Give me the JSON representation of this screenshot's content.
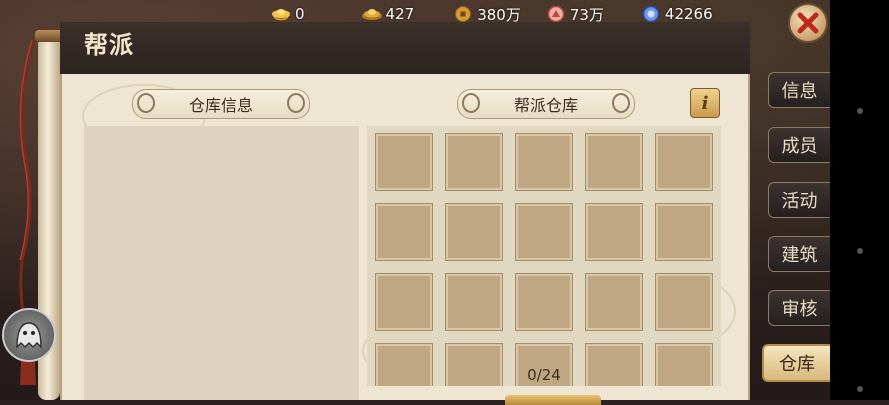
{
  "resources": [
    {
      "name": "gold-ingot",
      "icon": "gold-ingot-icon",
      "value": "0",
      "color": "#e6b93a"
    },
    {
      "name": "silver-ingot",
      "icon": "silver-ingot-icon",
      "value": "427",
      "color": "#d8a540"
    },
    {
      "name": "coins",
      "icon": "copper-coin-icon",
      "value": "380万",
      "color": "#c98a2e"
    },
    {
      "name": "vitality",
      "icon": "red-orb-icon",
      "value": "73万",
      "color": "#d0504a"
    },
    {
      "name": "energy",
      "icon": "blue-orb-icon",
      "value": "42266",
      "color": "#4f7fd6"
    }
  ],
  "panel": {
    "title": "帮派",
    "left_section_title": "仓库信息",
    "right_section_title": "帮派仓库",
    "info_button_label": "i",
    "slot_count": "0/24",
    "visible_slots": 20
  },
  "tabs": [
    {
      "label": "信息",
      "active": false
    },
    {
      "label": "成员",
      "active": false
    },
    {
      "label": "活动",
      "active": false
    },
    {
      "label": "建筑",
      "active": false
    },
    {
      "label": "审核",
      "active": false
    },
    {
      "label": "仓库",
      "active": true
    }
  ],
  "colors": {
    "parchment": "#eee6d2",
    "slot": "#bea782",
    "tab_active": "#d8b87c",
    "close_x": "#c0281e"
  }
}
